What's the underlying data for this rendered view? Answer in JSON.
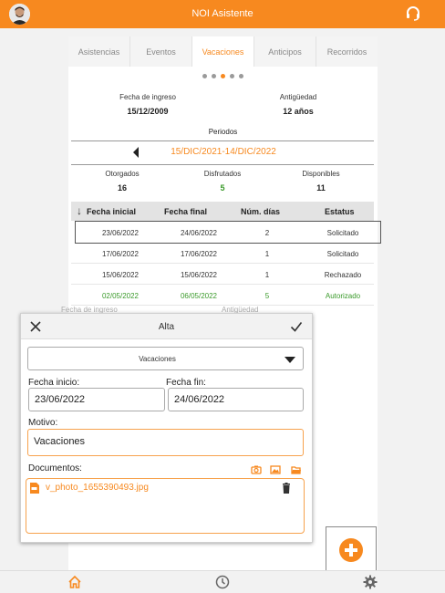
{
  "app": {
    "title": "NOI Asistente"
  },
  "tabs": [
    {
      "label": "Asistencias"
    },
    {
      "label": "Eventos"
    },
    {
      "label": "Vacaciones"
    },
    {
      "label": "Anticipos"
    },
    {
      "label": "Recorridos"
    }
  ],
  "pager": {
    "count": 5,
    "active_index": 2
  },
  "summary": {
    "fecha_ingreso_label": "Fecha de ingreso",
    "fecha_ingreso": "15/12/2009",
    "antiguedad_label": "Antigüedad",
    "antiguedad": "12 años",
    "periodos_label": "Periodos",
    "periodo": "15/DIC/2021-14/DIC/2022",
    "otorgados_label": "Otorgados",
    "otorgados": "16",
    "disfrutados_label": "Disfrutados",
    "disfrutados": "5",
    "disponibles_label": "Disponibles",
    "disponibles": "11"
  },
  "table": {
    "headers": [
      "Fecha inicial",
      "Fecha final",
      "Núm. días",
      "Estatus"
    ],
    "rows": [
      {
        "inicio": "23/06/2022",
        "fin": "24/06/2022",
        "dias": "2",
        "estatus": "Solicitado"
      },
      {
        "inicio": "17/06/2022",
        "fin": "17/06/2022",
        "dias": "1",
        "estatus": "Solicitado"
      },
      {
        "inicio": "15/06/2022",
        "fin": "15/06/2022",
        "dias": "1",
        "estatus": "Rechazado"
      },
      {
        "inicio": "02/05/2022",
        "fin": "06/05/2022",
        "dias": "5",
        "estatus": "Autorizado"
      }
    ]
  },
  "background_ghost": {
    "fecha_ingreso_label": "Fecha de ingreso",
    "antiguedad_label": "Antigüedad"
  },
  "modal": {
    "title": "Alta",
    "tipo": "Vacaciones",
    "fecha_inicio_label": "Fecha inicio:",
    "fecha_inicio": "23/06/2022",
    "fecha_fin_label": "Fecha fin:",
    "fecha_fin": "24/06/2022",
    "motivo_label": "Motivo:",
    "motivo": "Vacaciones",
    "documentos_label": "Documentos:",
    "archivo": "v_photo_1655390493.jpg"
  },
  "colors": {
    "accent": "#f7891f",
    "success": "#3a9a2a"
  },
  "icons": {
    "avatar": "avatar",
    "support": "headset-icon",
    "close": "close-icon",
    "confirm": "check-icon",
    "camera": "camera-icon",
    "image": "image-icon",
    "folder": "folder-icon",
    "file": "file-icon",
    "trash": "trash-icon",
    "add": "plus-icon",
    "home": "home-icon",
    "history": "clock-icon",
    "settings": "gear-icon"
  }
}
